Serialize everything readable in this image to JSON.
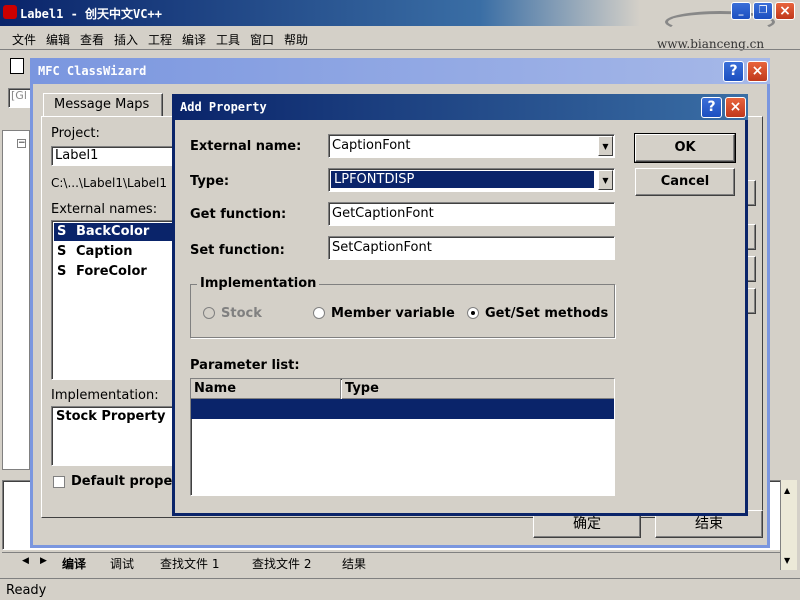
{
  "app": {
    "title": "Label1 - 创天中文VC++",
    "watermark": "www.bianceng.cn",
    "menu": [
      "文件",
      "编辑",
      "查看",
      "插入",
      "工程",
      "编译",
      "工具",
      "窗口",
      "帮助"
    ],
    "status": "Ready",
    "bottom_tabs": [
      "编译",
      "调试",
      "查找文件 1",
      "查找文件 2",
      "结果"
    ],
    "bg_combo": "[Gl"
  },
  "wizard": {
    "title": "MFC ClassWizard",
    "tab_message_maps": "Message Maps",
    "project_label": "Project:",
    "project_value": "Label1",
    "path": "C:\\...\\Label1\\Label1",
    "external_names_label": "External names:",
    "external_names": [
      {
        "prefix": "S",
        "name": "BackColor"
      },
      {
        "prefix": "S",
        "name": "Caption"
      },
      {
        "prefix": "S",
        "name": "ForeColor"
      }
    ],
    "implementation_label": "Implementation:",
    "implementation_value": "Stock Property",
    "default_property": "Default property",
    "ok_cn": "确定",
    "cancel_cn": "结束"
  },
  "dialog": {
    "title": "Add Property",
    "external_name_label": "External name:",
    "external_name_value": "CaptionFont",
    "type_label": "Type:",
    "type_value": "LPFONTDISP",
    "get_label": "Get function:",
    "get_value": "GetCaptionFont",
    "set_label": "Set function:",
    "set_value": "SetCaptionFont",
    "implementation_group": "Implementation",
    "radio_stock": "Stock",
    "radio_member": "Member variable",
    "radio_getset": "Get/Set methods",
    "param_label": "Parameter list:",
    "col_name": "Name",
    "col_type": "Type",
    "ok": "OK",
    "cancel": "Cancel"
  },
  "colors": {
    "selection": "#0a246a",
    "titlebar": "#0a246a"
  }
}
